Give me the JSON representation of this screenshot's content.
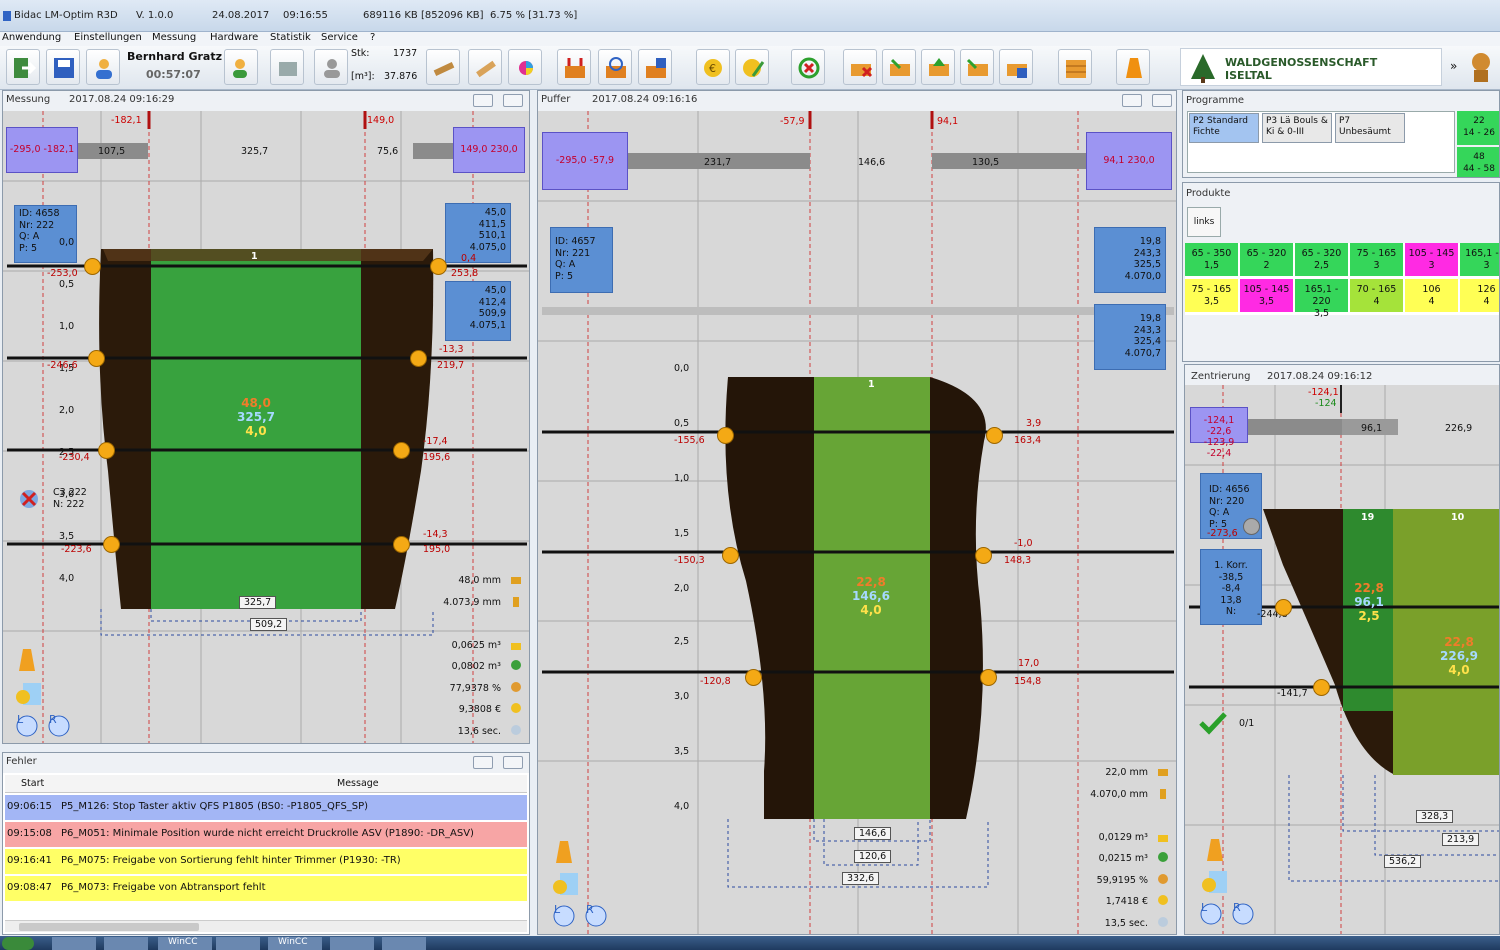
{
  "titlebar": {
    "app_name": "Bidac LM-Optim R3D",
    "version": "V. 1.0.0",
    "date": "24.08.2017",
    "time": "09:16:55",
    "memory": "689116 KB [852096 KB]",
    "cpu": "6.75 % [31.73 %]"
  },
  "menu": [
    "Anwendung",
    "Einstellungen",
    "Messung",
    "Hardware",
    "Statistik",
    "Service",
    "?"
  ],
  "toolbar": {
    "user_name": "Bernhard Gratz",
    "session_time": "00:57:07",
    "stk_label": "Stk:",
    "stk_value": "1737",
    "m3_label": "[m³]:",
    "m3_value": "37.876",
    "company_line1": "WALDGENOSSENSCHAFT",
    "company_line2": "ISELTAL",
    "overflow": "»"
  },
  "messung": {
    "title": "Messung",
    "timestamp": "2017.08.24 09:16:29",
    "left_pos_box": "-295,0 -182,1",
    "right_pos_box": "149,0 230,0",
    "marker_left": "-182,1",
    "marker_right": "149,0",
    "bar_val1": "107,5",
    "bar_val2": "325,7",
    "bar_val3": "75,6",
    "info_id": "ID: 4658",
    "info_nr": "Nr: 222",
    "info_q": "Q: A",
    "info_p": "P: 5",
    "right_box1": [
      "45,0",
      "411,5",
      "510,1",
      "4.075,0"
    ],
    "right_box2": [
      "45,0",
      "412,4",
      "509,9",
      "4.075,1"
    ],
    "scale": [
      "0,0",
      "0,5",
      "1,0",
      "1,5",
      "2,0",
      "2,5",
      "3,0",
      "3,5",
      "4,0"
    ],
    "left_readings": [
      "-253,0",
      "-246,6",
      "-230,4",
      "-223,6"
    ],
    "right_readings": [
      "0,4",
      "253,8",
      "-13,3",
      "219,7",
      "-17,4",
      "195,6",
      "-14,3",
      "195,0"
    ],
    "board_no": "1",
    "center_vals": [
      "48,0",
      "325,7",
      "4,0"
    ],
    "width_inner": "325,7",
    "width_outer": "509,2",
    "cam_label_c": "C3 222",
    "cam_label_n": "N: 222",
    "stats": [
      "48,0 mm",
      "4.073,9 mm",
      "0,0625 m³",
      "0,0802 m³",
      "77,9378 %",
      "9,3808 €",
      "13,6 sec."
    ]
  },
  "puffer": {
    "title": "Puffer",
    "timestamp": "2017.08.24 09:16:16",
    "left_pos_box": "-295,0 -57,9",
    "right_pos_box": "94,1 230,0",
    "marker_left": "-57,9",
    "marker_right": "94,1",
    "bar_val1": "231,7",
    "bar_val2": "146,6",
    "bar_val3": "130,5",
    "info_id": "ID: 4657",
    "info_nr": "Nr: 221",
    "info_q": "Q: A",
    "info_p": "P: 5",
    "right_box1": [
      "19,8",
      "243,3",
      "325,5",
      "4.070,0"
    ],
    "right_box2": [
      "19,8",
      "243,3",
      "325,4",
      "4.070,7"
    ],
    "scale": [
      "0,0",
      "0,5",
      "1,0",
      "1,5",
      "2,0",
      "2,5",
      "3,0",
      "3,5",
      "4,0"
    ],
    "left_readings": [
      "-155,6",
      "-150,3",
      "-120,8"
    ],
    "right_readings": [
      "3,9",
      "163,4",
      "-1,0",
      "148,3",
      "17,0",
      "154,8"
    ],
    "board_no": "1",
    "center_vals": [
      "22,8",
      "146,6",
      "4,0"
    ],
    "width_a": "146,6",
    "width_b": "120,6",
    "width_c": "332,6",
    "stats": [
      "22,0 mm",
      "4.070,0 mm",
      "0,0129 m³",
      "0,0215 m³",
      "59,9195 %",
      "1,7418 €",
      "13,5 sec."
    ]
  },
  "programme": {
    "title": "Programme",
    "items": [
      "P2 Standard Fichte",
      "P3 Lä Bouls & Ki & 0-III",
      "P7 Unbesäumt"
    ],
    "counter_top": [
      "22",
      "14 - 26"
    ],
    "counter_bottom": [
      "48",
      "44 - 58"
    ]
  },
  "produkte": {
    "title": "Produkte",
    "tab": "links",
    "rows": [
      [
        [
          "65 - 350",
          "1,5"
        ],
        [
          "65 - 320",
          "2"
        ],
        [
          "65 - 320",
          "2,5"
        ],
        [
          "75 - 165",
          "3"
        ],
        [
          "105 - 145",
          "3"
        ],
        [
          "165,1 - 2",
          "3"
        ]
      ],
      [
        [
          "75 - 165",
          "3,5"
        ],
        [
          "105 - 145",
          "3,5"
        ],
        [
          "165,1 - 220",
          "3,5"
        ],
        [
          "70 - 165",
          "4"
        ],
        [
          "106",
          "4"
        ],
        [
          "126",
          "4"
        ]
      ]
    ],
    "colors": [
      [
        "#35d65a",
        "#35d65a",
        "#35d65a",
        "#35d65a",
        "#ff2ae3",
        "#35d65a"
      ],
      [
        "#ffff55",
        "#ff2ae3",
        "#35d65a",
        "#a5e33a",
        "#ffff55",
        "#ffff55"
      ]
    ]
  },
  "zentrierung": {
    "title": "Zentrierung",
    "timestamp": "2017.08.24 09:16:12",
    "left_pos_box": [
      "-124,1 -22,6",
      "-123,9 -22,4"
    ],
    "marker1": "-124,1",
    "marker2": "-124",
    "bar_val1": "96,1",
    "bar_val2": "226,9",
    "info_id": "ID: 4656",
    "info_nr": "Nr: 220",
    "info_q": "Q: A",
    "info_p": "P: 5",
    "info_extra": "-273,6",
    "korr": [
      "1. Korr.",
      "-38,5",
      "-8,4",
      "13,8",
      "N:"
    ],
    "korr_side": "-244,8",
    "left_reading": "-141,7",
    "board1_no": "19",
    "board2_no": "10",
    "board1_vals": [
      "22,8",
      "96,1",
      "2,5"
    ],
    "board2_vals": [
      "22,8",
      "226,9",
      "4,0"
    ],
    "counter": "0/1",
    "width_a": "328,3",
    "width_b": "213,9",
    "width_c": "536,2"
  },
  "fehler": {
    "title": "Fehler",
    "col_start": "Start",
    "col_message": "Message",
    "rows": [
      {
        "time": "09:06:15",
        "msg": "P5_M126: Stop Taster aktiv QFS P1805 (BS0: -P1805_QFS_SP)",
        "color": "#a3b6f5"
      },
      {
        "time": "09:15:08",
        "msg": "P6_M051: Minimale Position wurde nicht erreicht Druckrolle ASV (P1890: -DR_ASV)",
        "color": "#f7a5a5"
      },
      {
        "time": "09:16:41",
        "msg": "P6_M075: Freigabe von Sortierung fehlt hinter Trimmer (P1930: -TR)",
        "color": "#ffff66"
      },
      {
        "time": "09:08:47",
        "msg": "P6_M073: Freigabe von Abtransport fehlt",
        "color": "#ffff66"
      }
    ]
  },
  "taskbar": {
    "items": [
      "WinCC",
      "WinCC"
    ]
  }
}
